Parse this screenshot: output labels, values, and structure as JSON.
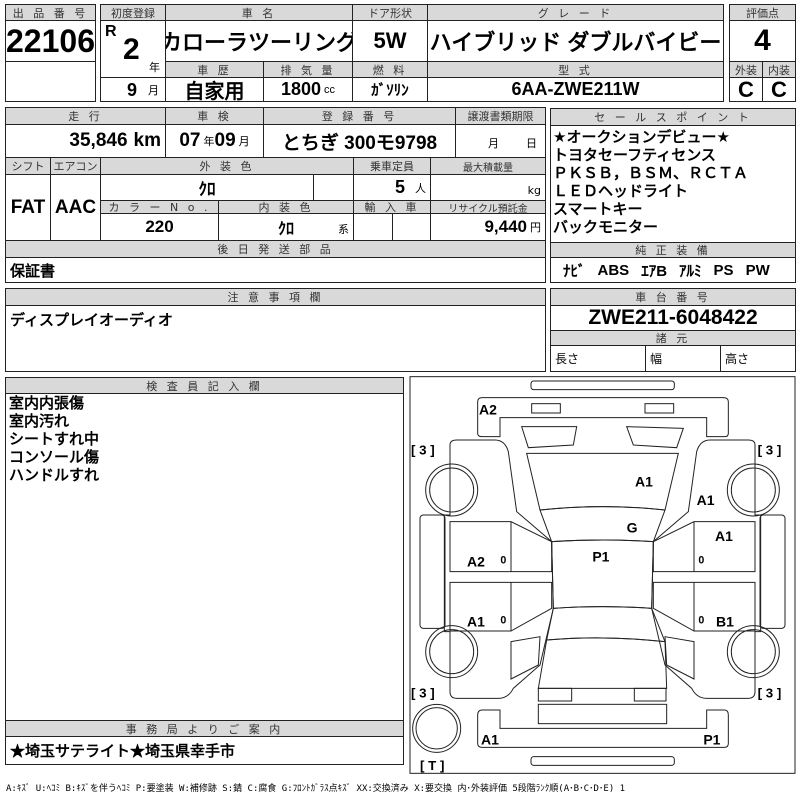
{
  "lot": {
    "label": "出 品 番 号",
    "value": "22106"
  },
  "first_reg": {
    "label": "初度登録",
    "era": "R",
    "year": "2",
    "year_unit": "年",
    "month": "9",
    "month_unit": "月"
  },
  "car_name": {
    "label": "車 名",
    "value": "カローラツーリング"
  },
  "doors": {
    "label": "ドア形状",
    "value": "5W"
  },
  "grade": {
    "label": "グ レ ー ド",
    "value": "ハイブリッド ダブルバイビー"
  },
  "score": {
    "label": "評価点",
    "value": "4",
    "exterior_label": "外装",
    "exterior": "C",
    "interior_label": "内装",
    "interior": "C"
  },
  "history": {
    "label": "車 歴",
    "value": "自家用"
  },
  "displacement": {
    "label": "排 気 量",
    "value": "1800",
    "unit": "cc"
  },
  "fuel": {
    "label": "燃 料",
    "value": "ｶﾞｿﾘﾝ"
  },
  "model_code": {
    "label": "型 式",
    "value": "6AA-ZWE211W"
  },
  "mileage": {
    "label": "走 行",
    "value": "35,846",
    "unit": "km"
  },
  "inspection": {
    "label": "車 検",
    "year": "07",
    "year_unit": "年",
    "month": "09",
    "month_unit": "月"
  },
  "plate": {
    "label": "登 録 番 号",
    "value": "とちぎ 300モ9798"
  },
  "transfer_deadline": {
    "label": "譲渡書類期限",
    "month_unit": "月",
    "day_unit": "日"
  },
  "shift": {
    "label": "シフト",
    "value": "FAT"
  },
  "aircon": {
    "label": "エアコン",
    "value": "AAC"
  },
  "ext_color": {
    "label": "外 装 色",
    "value": "ｸﾛ"
  },
  "capacity": {
    "label": "乗車定員",
    "value": "5",
    "unit": "人"
  },
  "max_load": {
    "label": "最大積載量",
    "unit": "kg"
  },
  "color_no": {
    "label": "カ ラ ー N o .",
    "value": "220"
  },
  "int_color": {
    "label": "内 装 色",
    "value": "ｸﾛ",
    "unit": "系"
  },
  "import": {
    "label": "輸 入 車"
  },
  "recycle": {
    "label": "リサイクル預託金",
    "value": "9,440",
    "unit": "円"
  },
  "later_parts": {
    "label": "後 日 発 送 部 品",
    "value": "保証書"
  },
  "notes": {
    "label": "注 意 事 項 欄",
    "value": "ディスプレイオーディオ"
  },
  "sales_points": {
    "label": "セ ー ル ス ポ イ ン ト",
    "items": [
      "★オークションデビュー★",
      "トヨタセーフティセンス",
      "ＰＫＳＢ，ＢＳＭ、ＲＣＴＡ",
      "ＬＥＤヘッドライト",
      "スマートキー",
      "バックモニター"
    ]
  },
  "equipment": {
    "label": "純 正 装 備",
    "items": [
      "ﾅﾋﾞ",
      "ABS",
      "ｴｱB",
      "ｱﾙﾐ",
      "PS",
      "PW"
    ]
  },
  "chassis": {
    "label": "車 台 番 号",
    "value": "ZWE211-6048422"
  },
  "specs": {
    "label": "諸 元",
    "length": "長さ",
    "width": "幅",
    "height": "高さ"
  },
  "inspector": {
    "label": "検 査 員 記 入 欄",
    "items": [
      "室内内張傷",
      "室内汚れ",
      "シートすれ中",
      "コンソール傷",
      "ハンドルすれ"
    ]
  },
  "office": {
    "label": "事 務 局 よ り ご 案 内",
    "value": "★埼玉サテライト★埼玉県幸手市"
  },
  "diagram": {
    "tread": [
      "[ 3 ]",
      "[ 3 ]",
      "[ 3 ]",
      "[ 3 ]"
    ],
    "spare": "[ T ]",
    "marks": {
      "front_bumper": "A2",
      "hood": "A1",
      "right_fender": "A1",
      "windshield": "G",
      "right_front_door": "A1",
      "roof": "P1",
      "left_front_door": "A2",
      "left_rear_door": "A1",
      "right_rear_door": "B1",
      "rear_bumper_left": "A1",
      "rear_bumper_right": "P1"
    },
    "door_marks": [
      "0",
      "0",
      "0",
      "0"
    ]
  },
  "legend": "A:ｷｽﾞ U:ﾍｺﾐ B:ｷｽﾞを伴うﾍｺﾐ P:要塗装 W:補修跡 S:錆 C:腐食 G:ﾌﾛﾝﾄｶﾞﾗｽ点ｷｽﾞ XX:交換済み X:要交換 内･外装評価 5段階ﾗﾝｸ順(A･B･C･D･E) 1"
}
